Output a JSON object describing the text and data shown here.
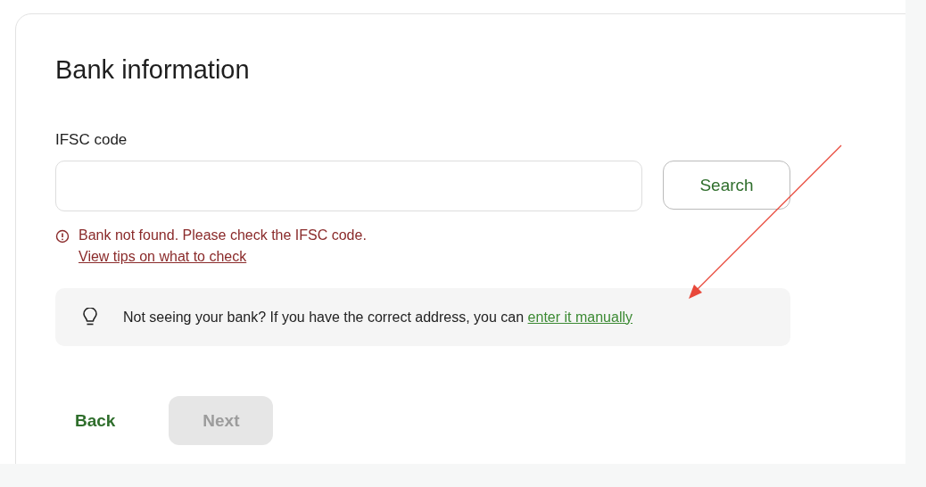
{
  "title": "Bank information",
  "ifsc": {
    "label": "IFSC code",
    "search_button": "Search"
  },
  "error": {
    "message": "Bank not found. Please check the IFSC code.",
    "link": "View tips on what to check"
  },
  "tip": {
    "text": "Not seeing your bank? If you have the correct address, you can ",
    "link": "enter it manually"
  },
  "buttons": [
    {
      "label": "Back",
      "disabled": false,
      "kind": "text"
    },
    {
      "label": "Next",
      "disabled": true,
      "kind": "filled"
    }
  ]
}
